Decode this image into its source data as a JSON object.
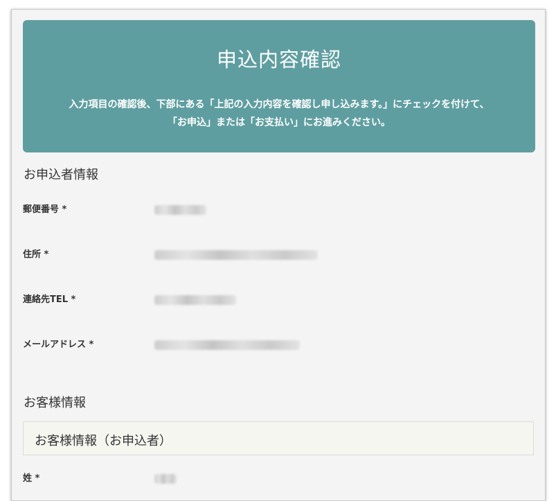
{
  "header": {
    "title": "申込内容確認",
    "description_line1": "入力項目の確認後、下部にある「上記の入力内容を確認し申し込みます。」にチェックを付けて、",
    "description_line2": "「お申込」または「お支払い」にお進みください。",
    "background_color": "#5f9ea0"
  },
  "applicant_section": {
    "title": "お申込者情報",
    "fields": [
      {
        "label": "郵便番号 *",
        "value_state": "blurred"
      },
      {
        "label": "住所 *",
        "value_state": "blurred"
      },
      {
        "label": "連絡先TEL *",
        "value_state": "blurred"
      },
      {
        "label": "メールアドレス *",
        "value_state": "blurred"
      }
    ]
  },
  "customer_section": {
    "title": "お客様情報",
    "subsection_title": "お客様情報（お申込者）",
    "fields": [
      {
        "label": "姓 *",
        "value_state": "blurred"
      }
    ]
  }
}
